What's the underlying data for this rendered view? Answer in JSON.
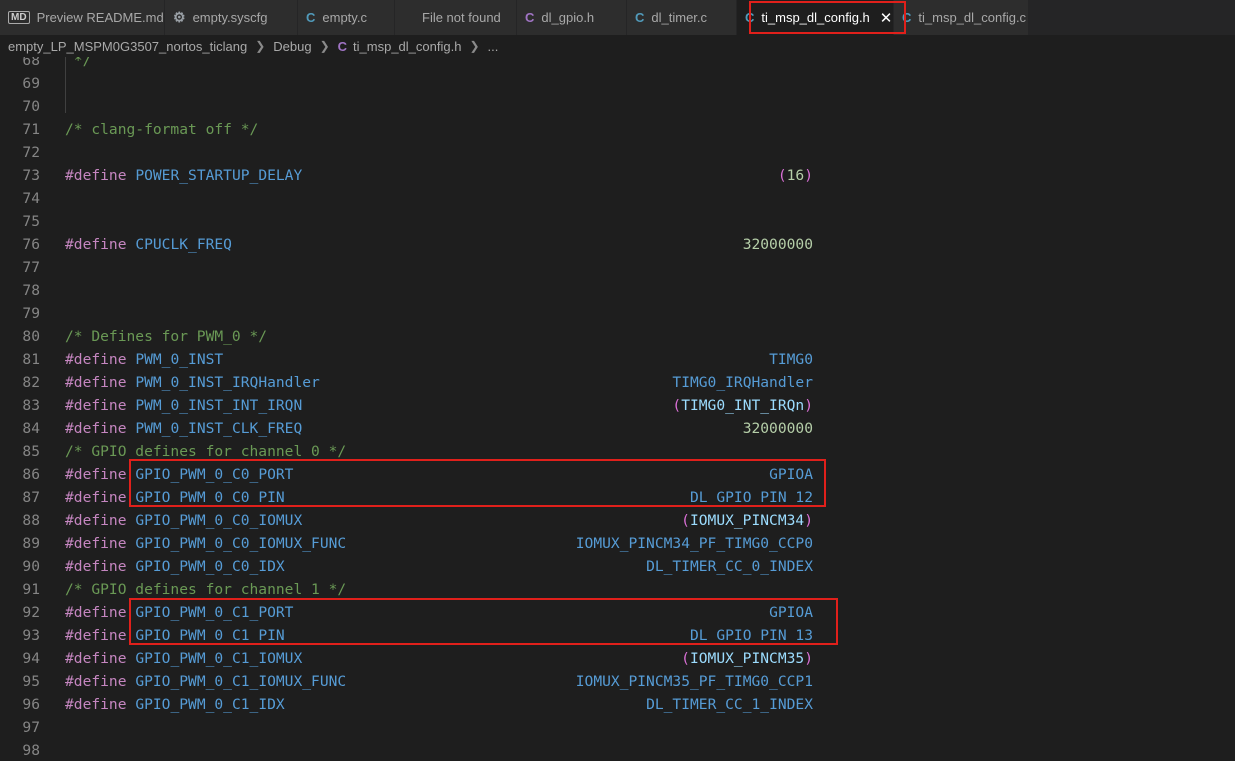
{
  "tabs": [
    {
      "icon": "md",
      "label": "Preview README.md",
      "active": false
    },
    {
      "icon": "gear",
      "label": "empty.syscfg",
      "active": false
    },
    {
      "icon": "c",
      "label": "empty.c",
      "active": false
    },
    {
      "icon": "",
      "label": "File not found",
      "active": false
    },
    {
      "icon": "h",
      "label": "dl_gpio.h",
      "active": false
    },
    {
      "icon": "c",
      "label": "dl_timer.c",
      "active": false
    },
    {
      "icon": "c",
      "label": "ti_msp_dl_config.h",
      "active": true
    },
    {
      "icon": "c",
      "label": "ti_msp_dl_config.c",
      "active": false
    }
  ],
  "breadcrumb": {
    "project": "empty_LP_MSPM0G3507_nortos_ticlang",
    "folder": "Debug",
    "file": "ti_msp_dl_config.h",
    "more": "..."
  },
  "code_lines": [
    {
      "n": "68",
      "t": "comment",
      "text": " */"
    },
    {
      "n": "69",
      "t": "blank"
    },
    {
      "n": "70",
      "t": "blank"
    },
    {
      "n": "71",
      "t": "comment",
      "text": "/* clang-format off */"
    },
    {
      "n": "72",
      "t": "blank"
    },
    {
      "n": "73",
      "t": "define",
      "name": "POWER_STARTUP_DELAY",
      "val": "(16)",
      "vt": "pnum"
    },
    {
      "n": "74",
      "t": "blank"
    },
    {
      "n": "75",
      "t": "blank"
    },
    {
      "n": "76",
      "t": "define",
      "name": "CPUCLK_FREQ",
      "val": "32000000",
      "vt": "num"
    },
    {
      "n": "77",
      "t": "blank"
    },
    {
      "n": "78",
      "t": "blank"
    },
    {
      "n": "79",
      "t": "blank"
    },
    {
      "n": "80",
      "t": "comment",
      "text": "/* Defines for PWM_0 */"
    },
    {
      "n": "81",
      "t": "define",
      "name": "PWM_0_INST",
      "val": "TIMG0",
      "vt": "mac"
    },
    {
      "n": "82",
      "t": "define",
      "name": "PWM_0_INST_IRQHandler",
      "val": "TIMG0_IRQHandler",
      "vt": "mac"
    },
    {
      "n": "83",
      "t": "define",
      "name": "PWM_0_INST_INT_IRQN",
      "val": "(TIMG0_INT_IRQn)",
      "vt": "pident"
    },
    {
      "n": "84",
      "t": "define",
      "name": "PWM_0_INST_CLK_FREQ",
      "val": "32000000",
      "vt": "num"
    },
    {
      "n": "85",
      "t": "comment",
      "text": "/* GPIO defines for channel 0 */"
    },
    {
      "n": "86",
      "t": "define",
      "name": "GPIO_PWM_0_C0_PORT",
      "val": "GPIOA",
      "vt": "mac"
    },
    {
      "n": "87",
      "t": "define",
      "name": "GPIO_PWM_0_C0_PIN",
      "val": "DL_GPIO_PIN_12",
      "vt": "mac"
    },
    {
      "n": "88",
      "t": "define",
      "name": "GPIO_PWM_0_C0_IOMUX",
      "val": "(IOMUX_PINCM34)",
      "vt": "pident"
    },
    {
      "n": "89",
      "t": "define",
      "name": "GPIO_PWM_0_C0_IOMUX_FUNC",
      "val": "IOMUX_PINCM34_PF_TIMG0_CCP0",
      "vt": "mac"
    },
    {
      "n": "90",
      "t": "define",
      "name": "GPIO_PWM_0_C0_IDX",
      "val": "DL_TIMER_CC_0_INDEX",
      "vt": "mac"
    },
    {
      "n": "91",
      "t": "comment",
      "text": "/* GPIO defines for channel 1 */"
    },
    {
      "n": "92",
      "t": "define",
      "name": "GPIO_PWM_0_C1_PORT",
      "val": "GPIOA",
      "vt": "mac"
    },
    {
      "n": "93",
      "t": "define",
      "name": "GPIO_PWM_0_C1_PIN",
      "val": "DL_GPIO_PIN_13",
      "vt": "mac"
    },
    {
      "n": "94",
      "t": "define",
      "name": "GPIO_PWM_0_C1_IOMUX",
      "val": "(IOMUX_PINCM35)",
      "vt": "pident"
    },
    {
      "n": "95",
      "t": "define",
      "name": "GPIO_PWM_0_C1_IOMUX_FUNC",
      "val": "IOMUX_PINCM35_PF_TIMG0_CCP1",
      "vt": "mac"
    },
    {
      "n": "96",
      "t": "define",
      "name": "GPIO_PWM_0_C1_IDX",
      "val": "DL_TIMER_CC_1_INDEX",
      "vt": "mac"
    },
    {
      "n": "97",
      "t": "blank"
    },
    {
      "n": "98",
      "t": "blank"
    }
  ],
  "keyword": "#define",
  "colors": {
    "highlight": "#e0201b",
    "keyword": "#c586c0",
    "macro": "#569cd6",
    "comment": "#6a9955",
    "number": "#b5cea8"
  }
}
